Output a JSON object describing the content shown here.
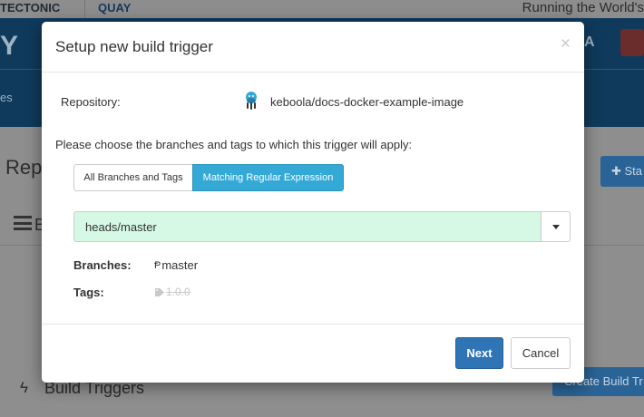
{
  "background": {
    "brand_left": "TECTONIC",
    "brand_right": "QUAY",
    "running_text": "Running the World's",
    "logo_letter": "Y",
    "nav_fragment": "es",
    "nav_letter": "A",
    "repo_heading_fragment": "Rep",
    "section_letter_fragment": "B",
    "star_button_fragment": "Sta",
    "build_triggers_title": "Build Triggers",
    "create_build_trigger_fragment": "Create Build Tr"
  },
  "modal": {
    "title": "Setup new build trigger",
    "close_symbol": "×",
    "repository_label": "Repository:",
    "repository_name": "keboola/docs-docker-example-image",
    "choose_text": "Please choose the branches and tags to which this trigger will apply:",
    "mode_options": {
      "all": "All Branches and Tags",
      "regex": "Matching Regular Expression"
    },
    "selected_mode": "Matching Regular Expression",
    "regex_value": "heads/master",
    "branches_label": "Branches:",
    "branch_value": "master",
    "tags_label": "Tags:",
    "tag_value": "1.0.0",
    "next_label": "Next",
    "cancel_label": "Cancel"
  },
  "colors": {
    "active_segment": "#35a9d6",
    "primary_button": "#2f75b5",
    "regex_match_bg": "#d5f9e5",
    "header_blue": "#0f3a5c"
  },
  "icons": {
    "repo": "docker-octopus-icon",
    "branch": "code-branch-icon",
    "tag": "tag-icon",
    "dropdown": "caret-down-icon"
  }
}
